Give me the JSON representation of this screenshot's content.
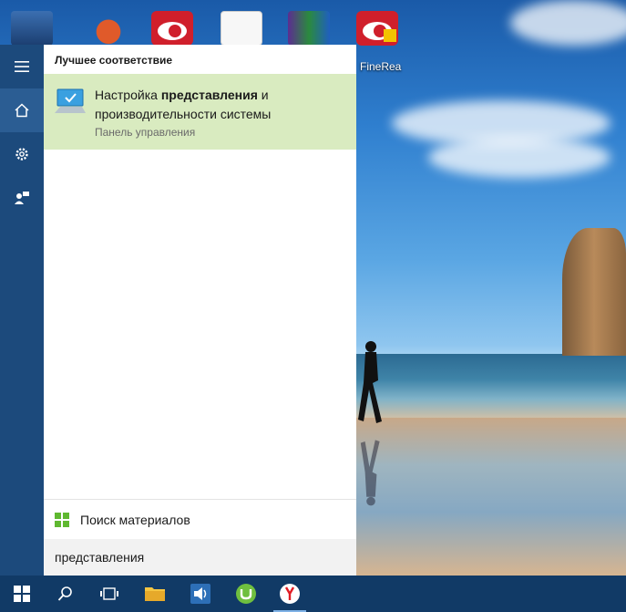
{
  "desktop": {
    "partial_icon_label": "FineRea"
  },
  "start_menu": {
    "best_match_header": "Лучшее соответствие",
    "best_match": {
      "title_before": "Настройка ",
      "title_bold": "представления",
      "title_after": " и",
      "title_line2": "производительности системы",
      "subtitle": "Панель управления"
    },
    "search_materials_label": "Поиск материалов",
    "search_query": "представления"
  },
  "colors": {
    "highlight": "#d9ebc0",
    "rail": "#1c4a7c",
    "taskbar": "#113a66",
    "windows_logo_green": "#5fb830"
  }
}
